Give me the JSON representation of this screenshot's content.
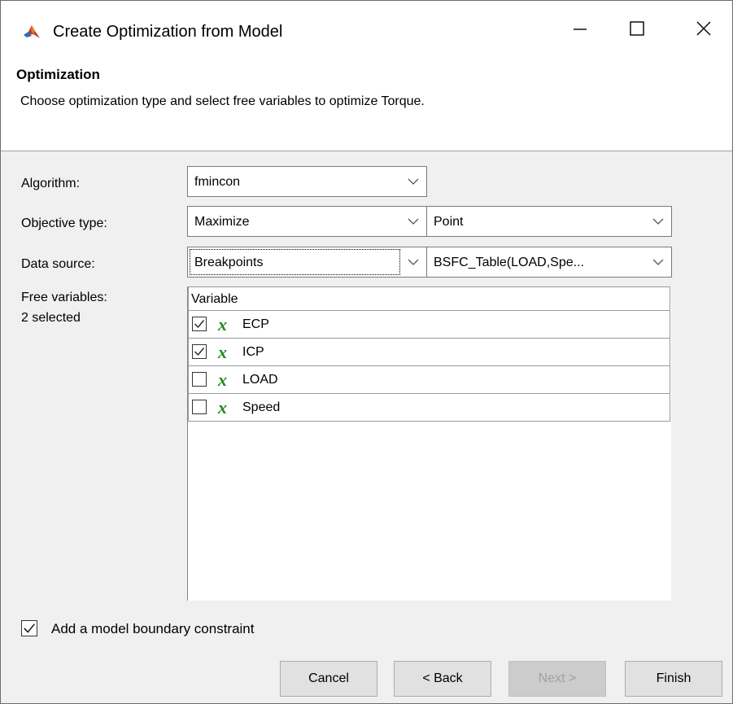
{
  "window": {
    "title": "Create Optimization from Model",
    "icon": "matlab-icon"
  },
  "header": {
    "title": "Optimization",
    "description": "Choose optimization type and select free variables to optimize Torque."
  },
  "form": {
    "algorithm": {
      "label": "Algorithm:",
      "value": "fmincon"
    },
    "objective_type": {
      "label": "Objective type:",
      "value": "Maximize",
      "secondary_value": "Point"
    },
    "data_source": {
      "label": "Data source:",
      "value": "Breakpoints",
      "secondary_value": "BSFC_Table(LOAD,Spe..."
    },
    "free_variables": {
      "label": "Free variables:",
      "count_text": "2 selected"
    }
  },
  "variables_table": {
    "header": "Variable",
    "rows": [
      {
        "name": "ECP",
        "checked": true,
        "icon": "x"
      },
      {
        "name": "ICP",
        "checked": true,
        "icon": "x"
      },
      {
        "name": "LOAD",
        "checked": false,
        "icon": "x"
      },
      {
        "name": "Speed",
        "checked": false,
        "icon": "x"
      }
    ]
  },
  "boundary_constraint": {
    "label": "Add a model boundary constraint",
    "checked": true
  },
  "buttons": {
    "cancel": "Cancel",
    "back": "< Back",
    "next": "Next >",
    "finish": "Finish"
  },
  "colors": {
    "variable_icon": "#1f8a1f",
    "dialog_background": "#f0f0f0"
  }
}
